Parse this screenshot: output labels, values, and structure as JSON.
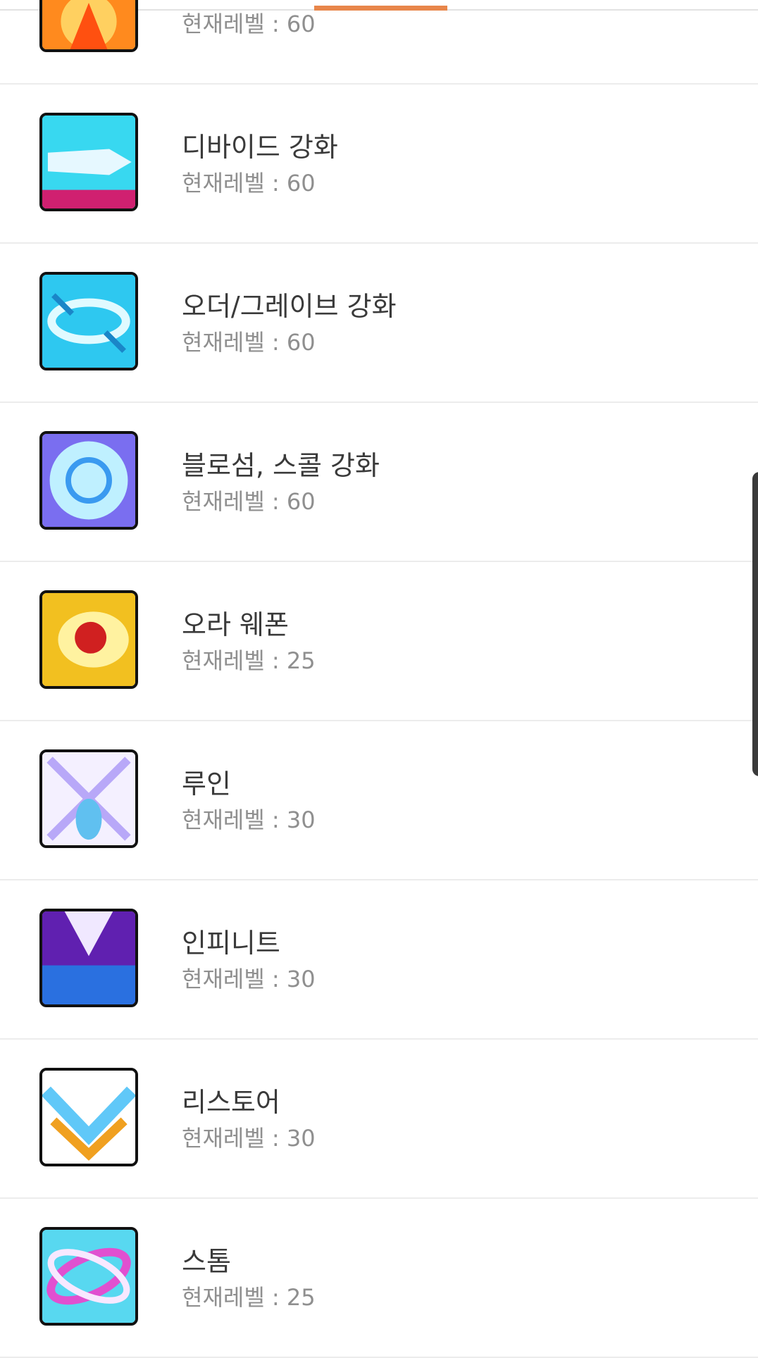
{
  "skills": [
    {
      "title": "",
      "level": "현재레벨 : 60",
      "icon": "fire-skill-icon",
      "colors": [
        "#ff8a1e",
        "#ffd060",
        "#ff5010"
      ]
    },
    {
      "title": "디바이드 강화",
      "level": "현재레벨 : 60",
      "icon": "divide-skill-icon",
      "colors": [
        "#38d8f0",
        "#e6f8ff",
        "#d02070"
      ]
    },
    {
      "title": "오더/그레이브 강화",
      "level": "현재레벨 : 60",
      "icon": "order-grave-skill-icon",
      "colors": [
        "#2ec8f0",
        "#e0faff",
        "#1a86c8"
      ]
    },
    {
      "title": "블로섬, 스콜 강화",
      "level": "현재레벨 : 60",
      "icon": "blossom-squall-skill-icon",
      "colors": [
        "#7a6ef0",
        "#bff0ff",
        "#3a9af0"
      ]
    },
    {
      "title": "오라 웨폰",
      "level": "현재레벨 : 25",
      "icon": "aura-weapon-skill-icon",
      "colors": [
        "#f2c020",
        "#fff2a0",
        "#d02020"
      ]
    },
    {
      "title": "루인",
      "level": "현재레벨 : 30",
      "icon": "ruin-skill-icon",
      "colors": [
        "#b8a8f8",
        "#f4f0ff",
        "#60c0f0"
      ]
    },
    {
      "title": "인피니트",
      "level": "현재레벨 : 30",
      "icon": "infinite-skill-icon",
      "colors": [
        "#6020b0",
        "#f0e8ff",
        "#2a70e0"
      ]
    },
    {
      "title": "리스토어",
      "level": "현재레벨 : 30",
      "icon": "restore-skill-icon",
      "colors": [
        "#60c8f8",
        "#ffffff",
        "#f0a020"
      ]
    },
    {
      "title": "스톰",
      "level": "현재레벨 : 25",
      "icon": "storm-skill-icon",
      "colors": [
        "#58d8f0",
        "#f8e8ff",
        "#e050d0"
      ]
    }
  ]
}
